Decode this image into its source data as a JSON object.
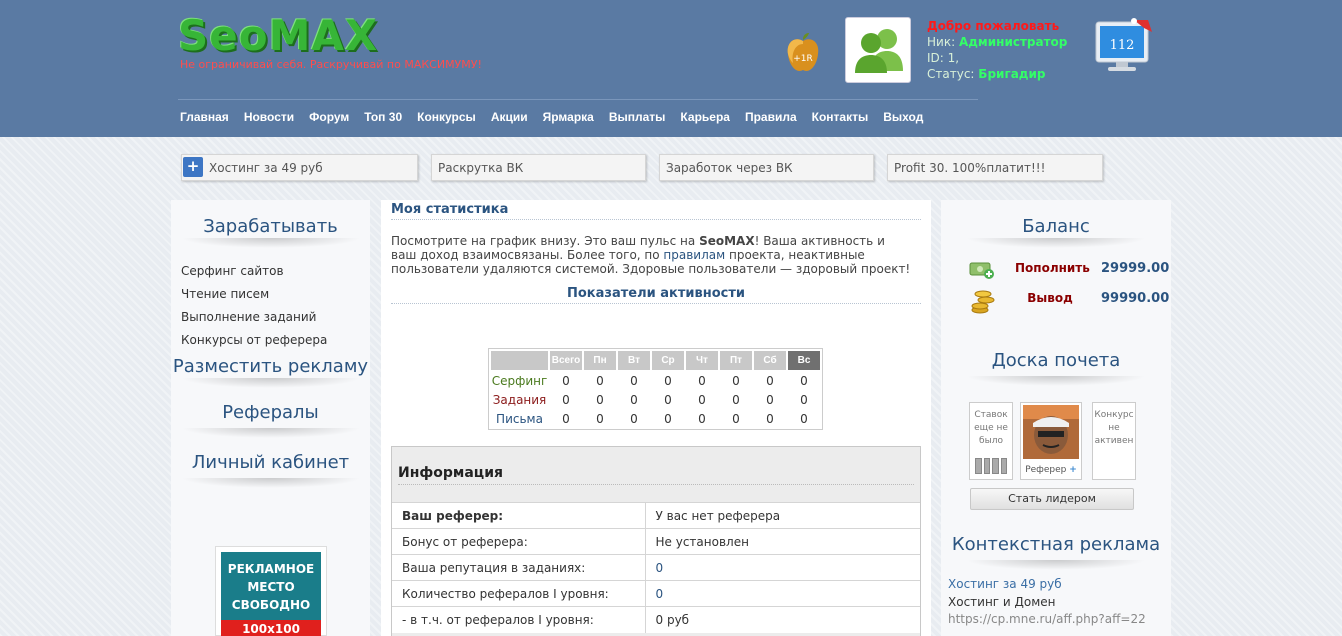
{
  "header": {
    "logo": "SeoMAX",
    "slogan": "Не ограничивай себя. Раскручивай по МАКСИМУМУ!",
    "apple_badge": "+1R",
    "welcome": "Добро пожаловать",
    "nick_label": "Ник:",
    "nick_value": "Администратор",
    "id_label": "ID:",
    "id_value": "1,",
    "status_label": "Статус:",
    "status_value": "Бригадир",
    "monitor_count": "112"
  },
  "nav": [
    "Главная",
    "Новости",
    "Форум",
    "Топ 30",
    "Конкурсы",
    "Акции",
    "Ярмарка",
    "Выплаты",
    "Карьера",
    "Правила",
    "Контакты",
    "Выход"
  ],
  "ticker": [
    "Хостинг за 49 руб",
    "Раскрутка ВК",
    "Заработок через ВК",
    "Profit 30. 100%платит!!!"
  ],
  "left_sidebar": {
    "earn_heading": "Зарабатывать",
    "earn_links": [
      "Серфинг сайтов",
      "Чтение писем",
      "Выполнение заданий",
      "Конкурсы от реферера"
    ],
    "ads_heading": "Разместить рекламу",
    "referrals_heading": "Рефералы",
    "cabinet_heading": "Личный кабинет",
    "ad_banner_text": "РЕКЛАМНОЕ МЕСТО СВОБОДНО",
    "ad_banner_size": "100x100"
  },
  "center": {
    "title": "Моя статистика",
    "intro_1": "Посмотрите на график внизу. Это ваш пульс на ",
    "intro_brand": "SeoMAX",
    "intro_2": "! Ваша активность и ваш доход взаимосвязаны. Более того, по ",
    "intro_link": "правилам",
    "intro_3": " проекта, неактивные пользователи удаляются системой. Здоровые пользователи — здоровый проект!",
    "activity_title": "Показатели активности",
    "activity_columns": [
      "Всего",
      "Пн",
      "Вт",
      "Ср",
      "Чт",
      "Пт",
      "Сб",
      "Вс"
    ],
    "activity_rows": [
      {
        "label": "Серфинг",
        "color": "#4a7a1e",
        "values": [
          "0",
          "0",
          "0",
          "0",
          "0",
          "0",
          "0",
          "0"
        ]
      },
      {
        "label": "Задания",
        "color": "#8b1a1a",
        "values": [
          "0",
          "0",
          "0",
          "0",
          "0",
          "0",
          "0",
          "0"
        ]
      },
      {
        "label": "Письма",
        "color": "#2b5480",
        "values": [
          "0",
          "0",
          "0",
          "0",
          "0",
          "0",
          "0",
          "0"
        ]
      }
    ],
    "info_title": "Информация",
    "info_rows": [
      {
        "label": "Ваш реферер:",
        "value": "У вас нет реферера"
      },
      {
        "label": "Бонус от реферера:",
        "value": "Не установлен"
      },
      {
        "label": "Ваша репутация в заданиях:",
        "value": "0"
      },
      {
        "label": "Количество рефералов I уровня:",
        "value": "0"
      },
      {
        "label": "- в т.ч. от рефералов I уровня:",
        "value": "0 руб"
      }
    ]
  },
  "right_sidebar": {
    "balance_heading": "Баланс",
    "deposit_label": "Пополнить",
    "deposit_value": "29999.00",
    "withdraw_label": "Вывод",
    "withdraw_value": "99990.00",
    "honor_heading": "Доска почета",
    "honor_left": "Ставок еще не было",
    "honor_middle": "Реферер",
    "honor_right": "Конкурс не активен",
    "leader_button": "Стать лидером",
    "context_heading": "Контекстная реклама",
    "context_link": "Хостинг за 49 руб",
    "context_desc": "Хостинг и Домен",
    "context_url": "https://cp.mne.ru/aff.php?aff=22"
  }
}
